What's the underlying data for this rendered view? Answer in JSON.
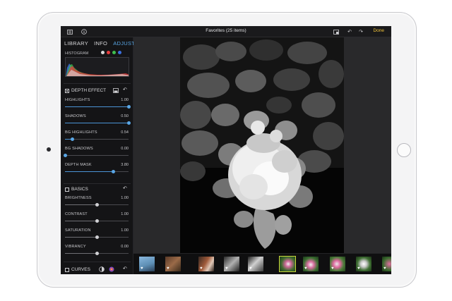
{
  "topbar": {
    "title": "Favorites (25 items)",
    "done_label": "Done",
    "icons": [
      "sidebar-toggle-icon",
      "info-circle-icon",
      "compare-icon",
      "undo-icon",
      "redo-icon"
    ]
  },
  "sidebar": {
    "tabs": [
      {
        "label": "LIBRARY",
        "active": false
      },
      {
        "label": "INFO",
        "active": false
      },
      {
        "label": "ADJUST",
        "active": true
      }
    ],
    "histogram": {
      "label": "HISTOGRAM",
      "channel_colors": [
        "#d9d9d9",
        "#e53b3b",
        "#3fbf4f",
        "#3b6fe0"
      ]
    },
    "depth_effect": {
      "label": "Depth Effect",
      "enabled": true,
      "sliders": [
        {
          "label": "Highlights",
          "value": "1.00",
          "level": 1.0
        },
        {
          "label": "Shadows",
          "value": "0.50",
          "level": 1.0
        },
        {
          "label": "Bg Highlights",
          "value": "0.54",
          "level": 0.12
        },
        {
          "label": "Bg Shadows",
          "value": "0.00",
          "level": 0.0
        },
        {
          "label": "Depth Mask",
          "value": "3.80",
          "level": 0.76
        }
      ]
    },
    "basics": {
      "label": "Basics",
      "enabled": false,
      "sliders": [
        {
          "label": "Brightness",
          "value": "1.00",
          "level": 0.5
        },
        {
          "label": "Contrast",
          "value": "1.00",
          "level": 0.5
        },
        {
          "label": "Saturation",
          "value": "1.00",
          "level": 0.5
        },
        {
          "label": "Vibrancy",
          "value": "0.00",
          "level": 0.5
        }
      ]
    },
    "curves": {
      "label": "Curves",
      "enabled": false
    }
  },
  "colors": {
    "accent": "#5aa7e6",
    "done": "#f1c33a",
    "selected_thumb": "#c8d63a"
  }
}
